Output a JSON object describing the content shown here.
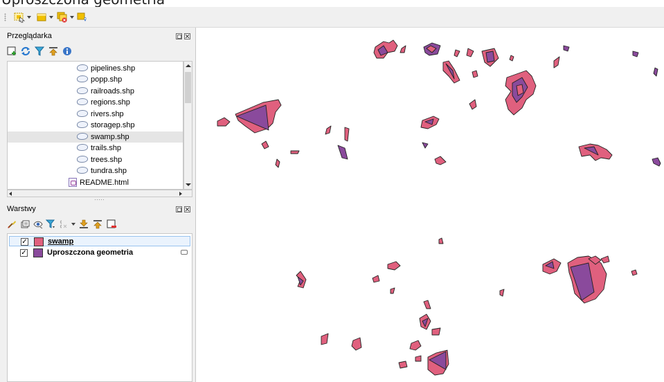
{
  "caption": {
    "text": "Uproszczona geometria"
  },
  "toolbar": {
    "buttons": [
      {
        "icon": "select-features-icon"
      },
      {
        "icon": "deselect-icon"
      },
      {
        "icon": "remove-selection-icon"
      },
      {
        "icon": "select-location-icon"
      }
    ]
  },
  "browser": {
    "title": "Przeglądarka",
    "tools": [
      "add-layer-icon",
      "refresh-icon",
      "filter-icon",
      "collapse-icon",
      "info-icon"
    ],
    "items": [
      {
        "label": "pipelines.shp",
        "type": "shp"
      },
      {
        "label": "popp.shp",
        "type": "shp"
      },
      {
        "label": "railroads.shp",
        "type": "shp"
      },
      {
        "label": "regions.shp",
        "type": "shp"
      },
      {
        "label": "rivers.shp",
        "type": "shp"
      },
      {
        "label": "storagep.shp",
        "type": "shp"
      },
      {
        "label": "swamp.shp",
        "type": "shp",
        "selected": true
      },
      {
        "label": "trails.shp",
        "type": "shp"
      },
      {
        "label": "trees.shp",
        "type": "shp"
      },
      {
        "label": "tundra.shp",
        "type": "shp"
      },
      {
        "label": "README.html",
        "type": "html"
      }
    ]
  },
  "layers": {
    "title": "Warstwy",
    "tools": [
      "style-icon",
      "add-group-icon",
      "visibility-icon",
      "filter-legend-icon",
      "expression-icon",
      "expand-icon",
      "collapse-icon",
      "remove-layer-icon"
    ],
    "items": [
      {
        "label": "swamp",
        "checked": true,
        "color": "#e0607e",
        "selected": true
      },
      {
        "label": "Uproszczona geometria",
        "checked": true,
        "color": "#8a4a9c",
        "selected": false
      }
    ]
  },
  "map": {
    "fill_color": "#e0607e",
    "simplified_color": "#8a4a9c",
    "outline_color": "#222222"
  }
}
